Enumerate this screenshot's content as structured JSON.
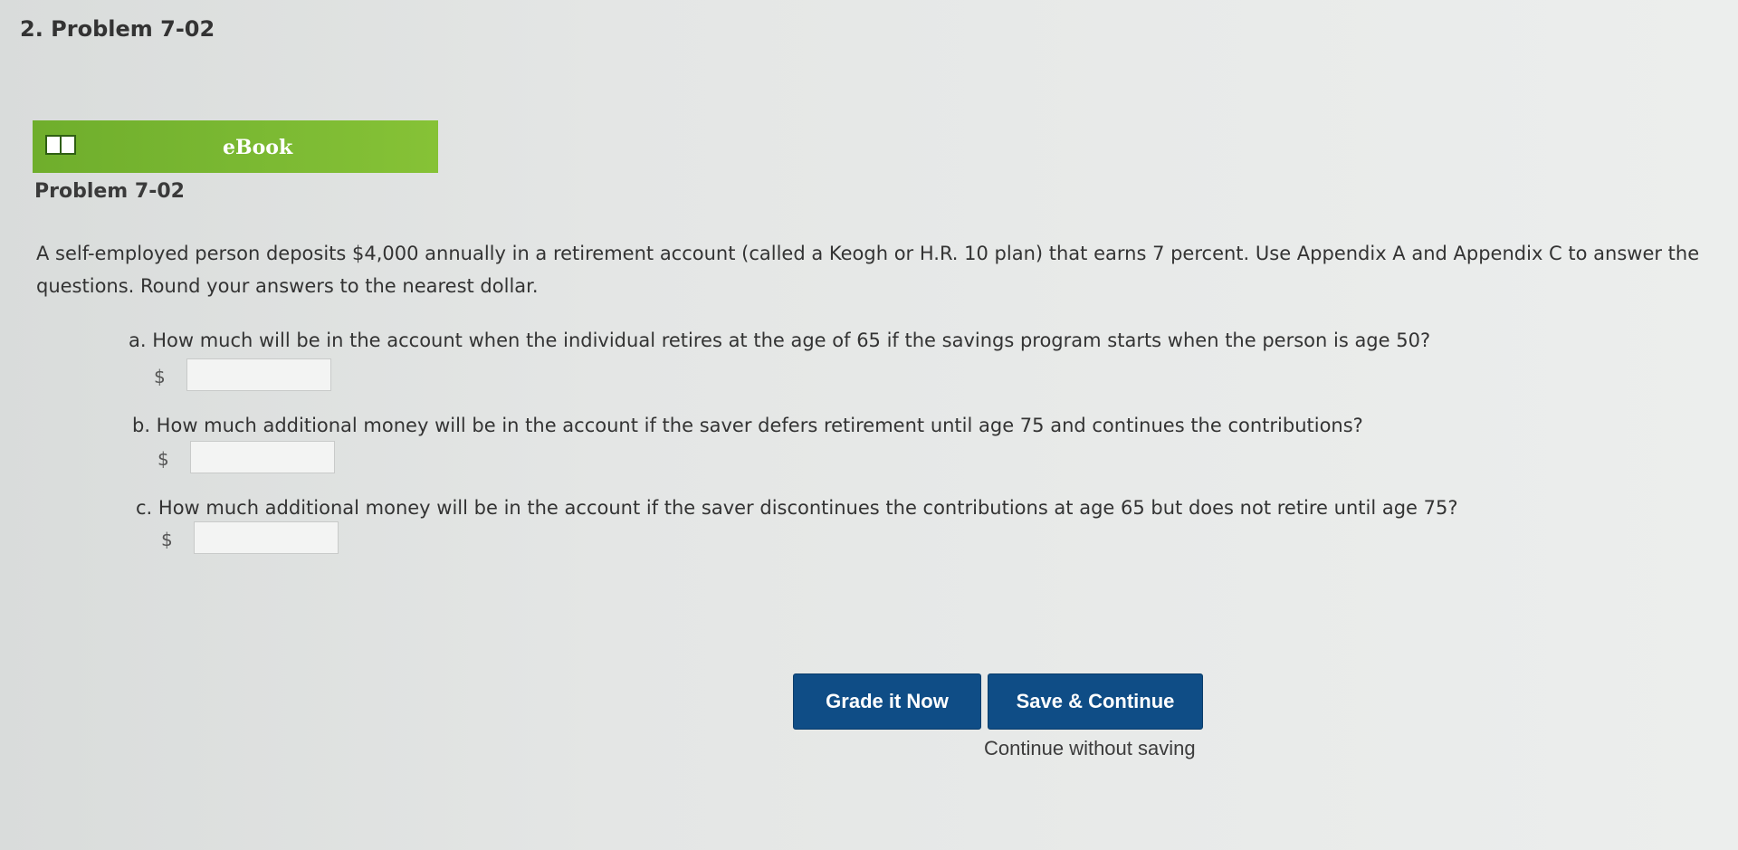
{
  "header": {
    "heading": "2. Problem 7-02"
  },
  "ebook": {
    "label": "eBook",
    "icon": "book-icon"
  },
  "problem": {
    "title": "Problem 7-02",
    "intro": "A self-employed person deposits $4,000 annually in a retirement account (called a Keogh or H.R. 10 plan) that earns 7 percent. Use Appendix A and Appendix C to answer the questions. Round your answers to the nearest dollar."
  },
  "questions": [
    {
      "text": "a. How much will be in the account when the individual retires at the age of 65 if the savings program starts when the person is age 50?",
      "currency": "$",
      "value": ""
    },
    {
      "text": "b. How much additional money will be in the account if the saver defers retirement until age 75 and continues the contributions?",
      "currency": "$",
      "value": ""
    },
    {
      "text": "c. How much additional money will be in the account if the saver discontinues the contributions at age 65 but does not retire until age 75?",
      "currency": "$",
      "value": ""
    }
  ],
  "actions": {
    "grade_label": "Grade it Now",
    "save_label": "Save & Continue",
    "continue_label": "Continue without saving"
  },
  "colors": {
    "ebook_green": "#7cba33",
    "button_blue": "#0f4d86"
  }
}
